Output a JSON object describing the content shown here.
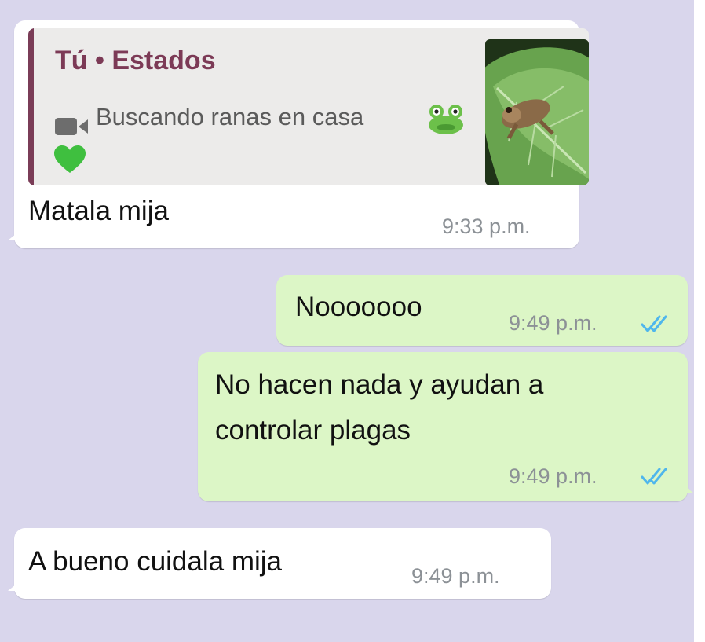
{
  "colors": {
    "chat_background": "#d9d6ec",
    "incoming_bubble": "#ffffff",
    "outgoing_bubble": "#dcf6c6",
    "quote_author": "#7c3a56",
    "timestamp": "#8c9196",
    "read_ticks": "#4fb6ec"
  },
  "messages": [
    {
      "direction": "incoming",
      "reply_to": {
        "author": "Tú • Estados",
        "type_icon": "video-camera-icon",
        "caption": "Buscando ranas en casa",
        "emojis": [
          "frog-emoji",
          "green-heart-emoji"
        ],
        "thumbnail": "frog-on-leaf-thumbnail"
      },
      "text": "Matala mija",
      "time": "9:33 p.m."
    },
    {
      "direction": "outgoing",
      "text": "Nooooooo",
      "time": "9:49 p.m.",
      "status_icon": "double-check-read-icon"
    },
    {
      "direction": "outgoing",
      "text_lines": [
        "No hacen nada y ayudan a",
        "controlar plagas"
      ],
      "time": "9:49 p.m.",
      "status_icon": "double-check-read-icon"
    },
    {
      "direction": "incoming",
      "text": "A bueno cuidala mija",
      "time": "9:49 p.m."
    }
  ]
}
